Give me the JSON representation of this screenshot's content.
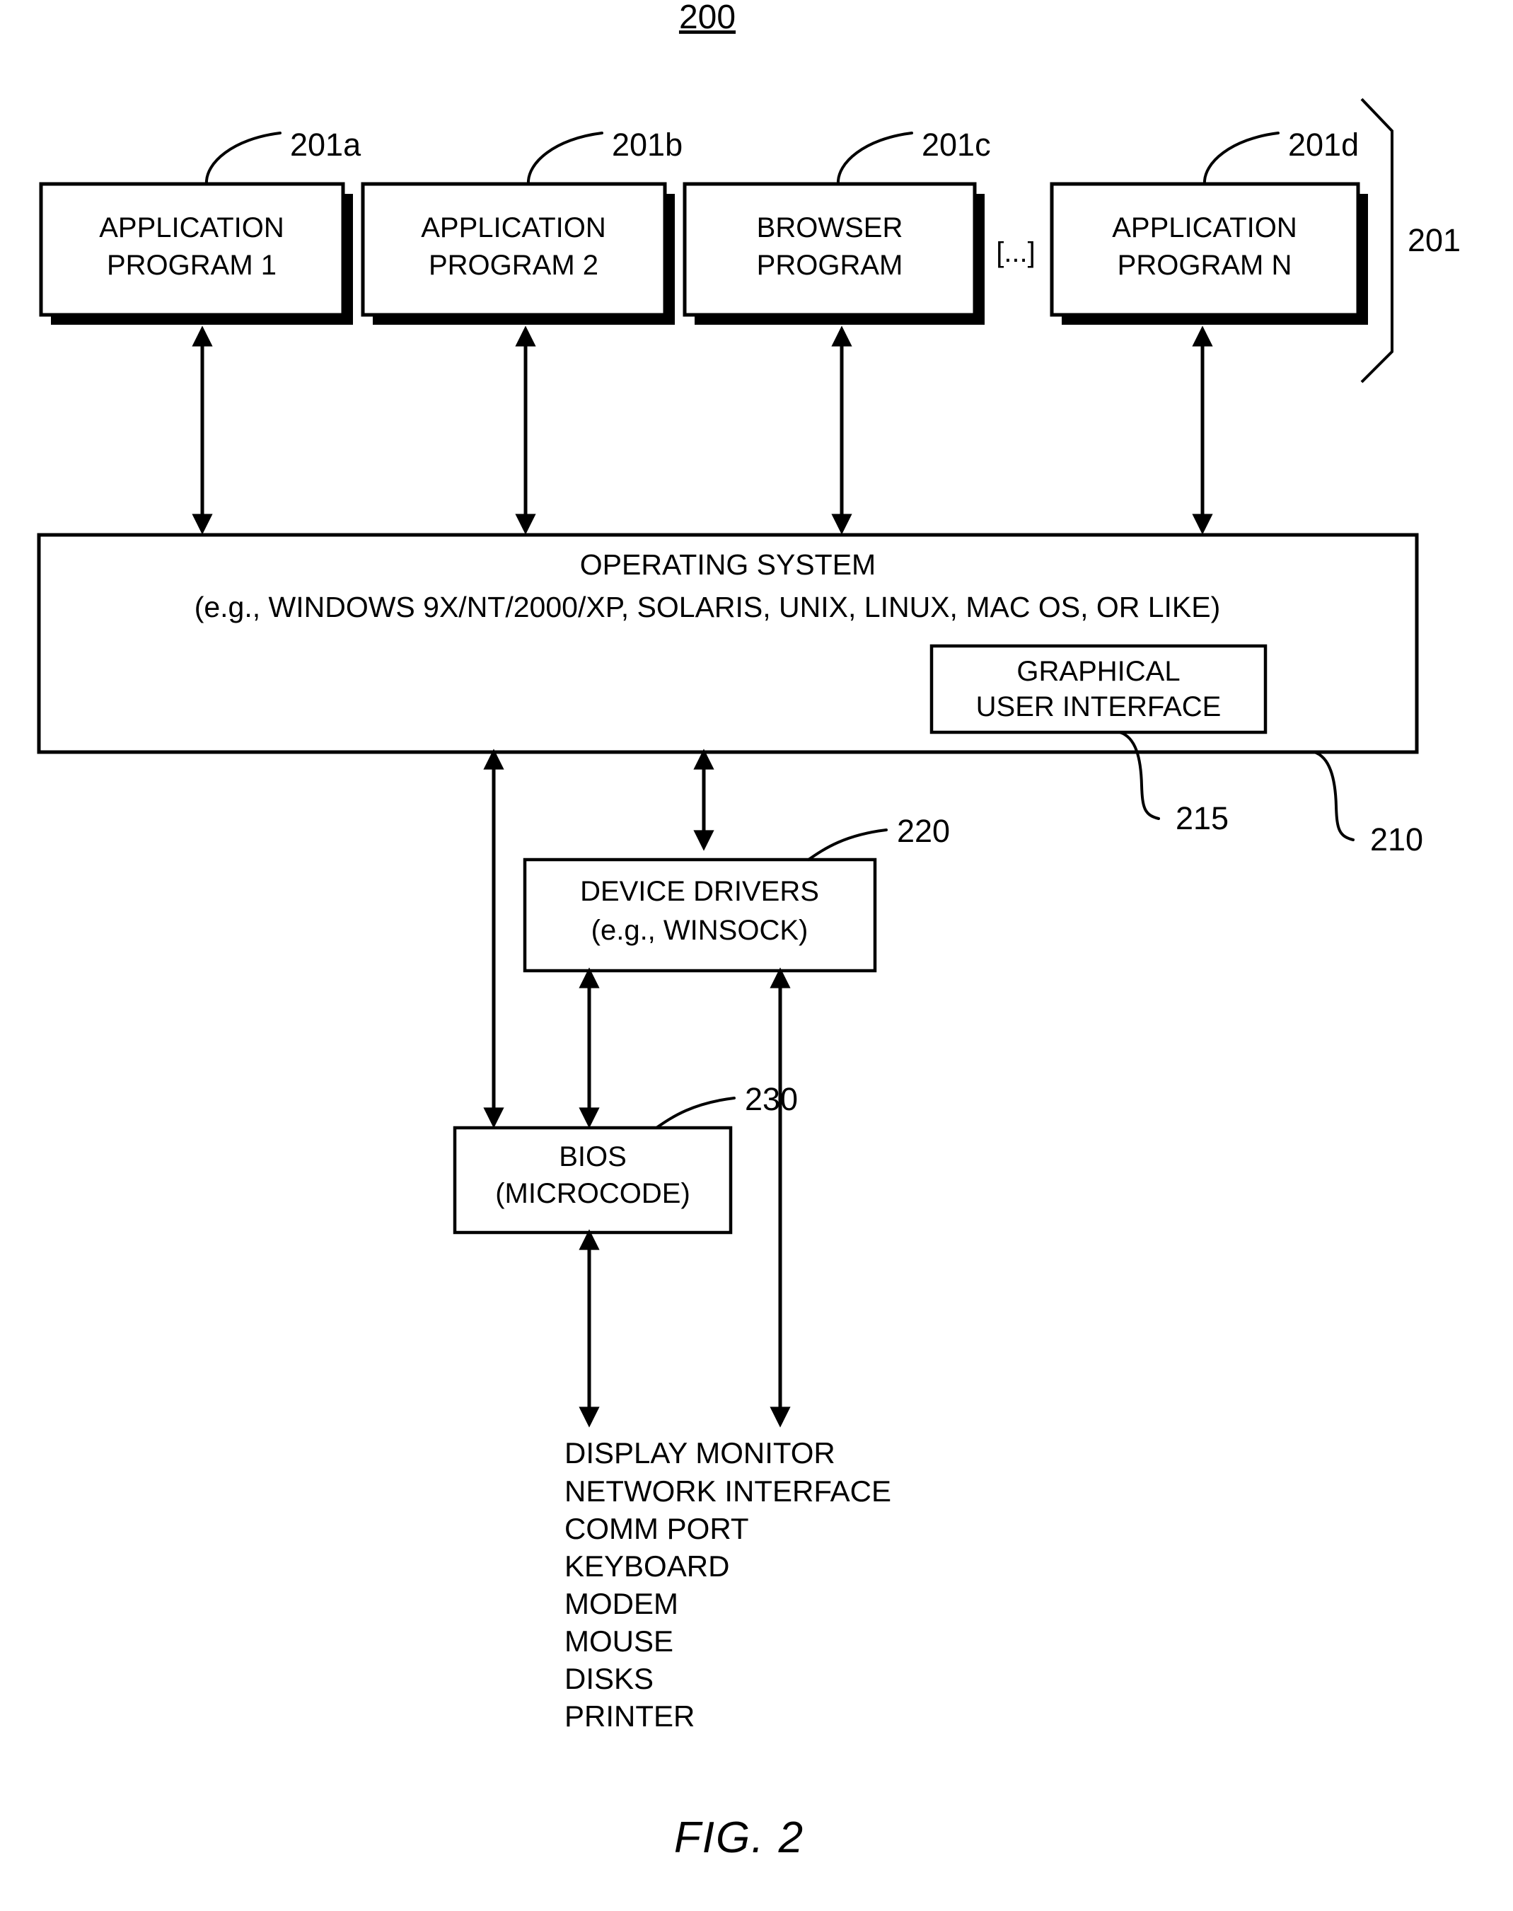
{
  "figure": {
    "number_label": "200",
    "caption": "FIG. 2"
  },
  "application_layer": {
    "group_ref": "201",
    "ellipsis": "[...]",
    "programs": [
      {
        "ref": "201a",
        "line1": "APPLICATION",
        "line2": "PROGRAM 1"
      },
      {
        "ref": "201b",
        "line1": "APPLICATION",
        "line2": "PROGRAM 2"
      },
      {
        "ref": "201c",
        "line1": "BROWSER",
        "line2": "PROGRAM"
      },
      {
        "ref": "201d",
        "line1": "APPLICATION",
        "line2": "PROGRAM N"
      }
    ]
  },
  "operating_system": {
    "ref": "210",
    "title": "OPERATING SYSTEM",
    "subtitle": "(e.g., WINDOWS 9X/NT/2000/XP, SOLARIS, UNIX, LINUX, MAC OS, OR LIKE)",
    "gui": {
      "ref": "215",
      "line1": "GRAPHICAL",
      "line2": "USER INTERFACE"
    }
  },
  "device_drivers": {
    "ref": "220",
    "line1": "DEVICE DRIVERS",
    "line2": "(e.g., WINSOCK)"
  },
  "bios": {
    "ref": "230",
    "line1": "BIOS",
    "line2": "(MICROCODE)"
  },
  "devices": [
    "DISPLAY MONITOR",
    "NETWORK INTERFACE",
    "COMM PORT",
    "KEYBOARD",
    "MODEM",
    "MOUSE",
    "DISKS",
    "PRINTER"
  ],
  "colors": {
    "ink": "#000000",
    "paper": "#ffffff"
  }
}
